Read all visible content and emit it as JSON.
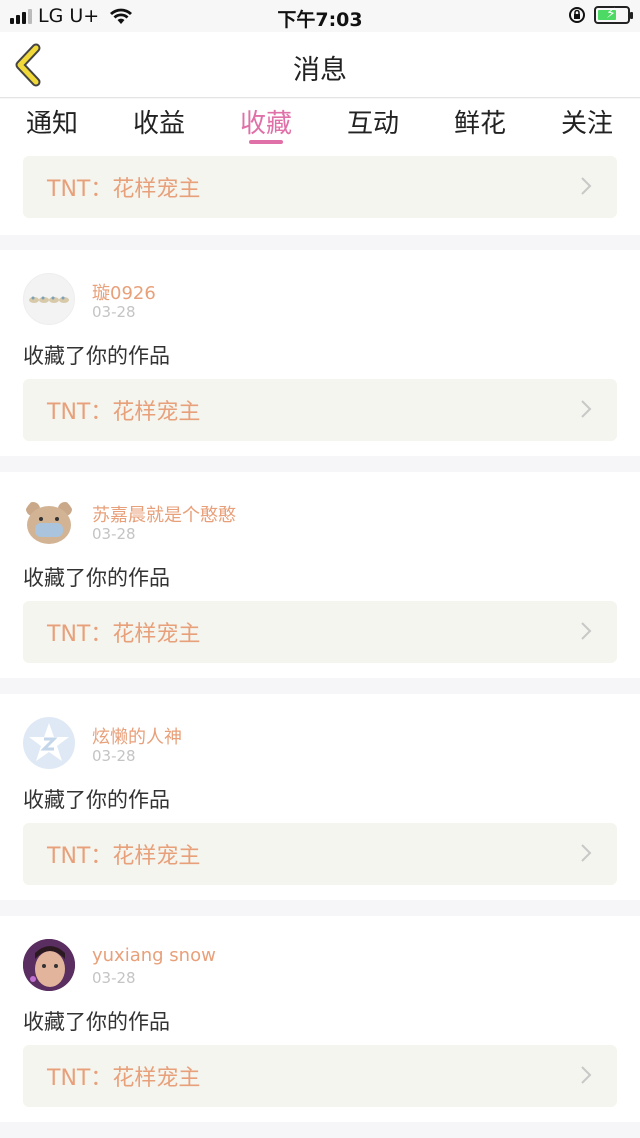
{
  "status_bar": {
    "carrier": "LG U+",
    "time": "下午7:03"
  },
  "nav": {
    "title": "消息",
    "back_icon": "chevron-left-icon"
  },
  "tabs": [
    {
      "label": "通知"
    },
    {
      "label": "收益"
    },
    {
      "label": "收藏",
      "active": true
    },
    {
      "label": "互动"
    },
    {
      "label": "鲜花"
    },
    {
      "label": "关注"
    }
  ],
  "colors": {
    "accent": "#e070a8",
    "username": "#e8a07a",
    "work_bg": "#f4f5ee"
  },
  "top_work": {
    "title": "TNT：花样宠主"
  },
  "items": [
    {
      "user": "璇0926",
      "date": "03-28",
      "action": "收藏了你的作品",
      "work": "TNT：花样宠主"
    },
    {
      "user": "苏嘉晨就是个憨憨",
      "date": "03-28",
      "action": "收藏了你的作品",
      "work": "TNT：花样宠主"
    },
    {
      "user": "炫懒的人神",
      "date": "03-28",
      "action": "收藏了你的作品",
      "work": "TNT：花样宠主"
    },
    {
      "user": "yuxiang snow",
      "date": "03-28",
      "action": "收藏了你的作品",
      "work": "TNT：花样宠主"
    }
  ]
}
